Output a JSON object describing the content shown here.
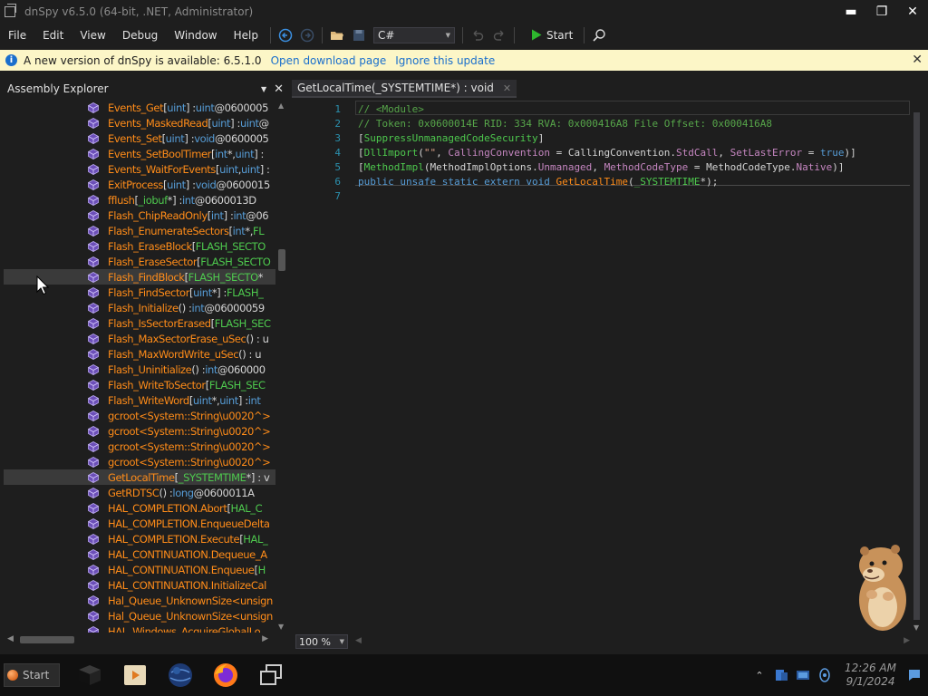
{
  "window": {
    "title": "dnSpy v6.5.0 (64-bit, .NET, Administrator)",
    "minimize": "▬",
    "maximize": "❐",
    "close": "✕"
  },
  "menu": {
    "items": [
      "File",
      "Edit",
      "View",
      "Debug",
      "Window",
      "Help"
    ]
  },
  "toolbar": {
    "language": "C#",
    "start_label": "Start"
  },
  "infobar": {
    "message": "A new version of dnSpy is available: 6.5.1.0",
    "open_download": "Open download page",
    "ignore_update": "Ignore this update",
    "close": "✕"
  },
  "assembly_explorer": {
    "title": "Assembly Explorer",
    "rows": [
      [
        [
          "n",
          "Events_Get"
        ],
        [
          "p",
          "["
        ],
        [
          "k",
          "uint"
        ],
        [
          "p",
          "] : "
        ],
        [
          "k",
          "uint"
        ],
        [
          "t",
          " @0600005"
        ]
      ],
      [
        [
          "n",
          "Events_MaskedRead"
        ],
        [
          "p",
          "["
        ],
        [
          "k",
          "uint"
        ],
        [
          "p",
          "] : "
        ],
        [
          "k",
          "uint"
        ],
        [
          "t",
          " @"
        ]
      ],
      [
        [
          "n",
          "Events_Set"
        ],
        [
          "p",
          "["
        ],
        [
          "k",
          "uint"
        ],
        [
          "p",
          "] : "
        ],
        [
          "k",
          "void"
        ],
        [
          "t",
          " @0600005"
        ]
      ],
      [
        [
          "n",
          "Events_SetBoolTimer"
        ],
        [
          "p",
          "["
        ],
        [
          "k",
          "int"
        ],
        [
          "p",
          "*, "
        ],
        [
          "k",
          "uint"
        ],
        [
          "p",
          "] :"
        ]
      ],
      [
        [
          "n",
          "Events_WaitForEvents"
        ],
        [
          "p",
          "["
        ],
        [
          "k",
          "uint"
        ],
        [
          "p",
          ", "
        ],
        [
          "k",
          "uint"
        ],
        [
          "p",
          "] :"
        ]
      ],
      [
        [
          "n",
          "ExitProcess"
        ],
        [
          "p",
          "["
        ],
        [
          "k",
          "uint"
        ],
        [
          "p",
          "] : "
        ],
        [
          "k",
          "void"
        ],
        [
          "t",
          " @0600015"
        ]
      ],
      [
        [
          "n",
          "fflush"
        ],
        [
          "p",
          "["
        ],
        [
          "y",
          "_iobuf"
        ],
        [
          "p",
          "*] : "
        ],
        [
          "k",
          "int"
        ],
        [
          "t",
          " @0600013D"
        ]
      ],
      [
        [
          "n",
          "Flash_ChipReadOnly"
        ],
        [
          "p",
          "["
        ],
        [
          "k",
          "int"
        ],
        [
          "p",
          "] : "
        ],
        [
          "k",
          "int"
        ],
        [
          "t",
          " @06"
        ]
      ],
      [
        [
          "n",
          "Flash_EnumerateSectors"
        ],
        [
          "p",
          "["
        ],
        [
          "k",
          "int"
        ],
        [
          "p",
          "*, "
        ],
        [
          "y",
          "FL"
        ]
      ],
      [
        [
          "n",
          "Flash_EraseBlock"
        ],
        [
          "p",
          "["
        ],
        [
          "y",
          "FLASH_SECTO"
        ]
      ],
      [
        [
          "n",
          "Flash_EraseSector"
        ],
        [
          "p",
          "["
        ],
        [
          "y",
          "FLASH_SECTO"
        ]
      ],
      [
        [
          "n",
          "Flash_FindBlock"
        ],
        [
          "p",
          "["
        ],
        [
          "y",
          "FLASH_SECTO"
        ],
        [
          "p",
          "*"
        ]
      ],
      [
        [
          "n",
          "Flash_FindSector"
        ],
        [
          "p",
          "["
        ],
        [
          "k",
          "uint"
        ],
        [
          "p",
          "*] : "
        ],
        [
          "y",
          "FLASH_"
        ]
      ],
      [
        [
          "n",
          "Flash_Initialize"
        ],
        [
          "p",
          "() : "
        ],
        [
          "k",
          "int"
        ],
        [
          "t",
          " @06000059"
        ]
      ],
      [
        [
          "n",
          "Flash_IsSectorErased"
        ],
        [
          "p",
          "["
        ],
        [
          "y",
          "FLASH_SEC"
        ]
      ],
      [
        [
          "n",
          "Flash_MaxSectorErase_uSec"
        ],
        [
          "p",
          "() : u"
        ]
      ],
      [
        [
          "n",
          "Flash_MaxWordWrite_uSec"
        ],
        [
          "p",
          "() : u"
        ]
      ],
      [
        [
          "n",
          "Flash_Uninitialize"
        ],
        [
          "p",
          "() : "
        ],
        [
          "k",
          "int"
        ],
        [
          "t",
          " @060000"
        ]
      ],
      [
        [
          "n",
          "Flash_WriteToSector"
        ],
        [
          "p",
          "["
        ],
        [
          "y",
          "FLASH_SEC"
        ]
      ],
      [
        [
          "n",
          "Flash_WriteWord"
        ],
        [
          "p",
          "["
        ],
        [
          "k",
          "uint"
        ],
        [
          "p",
          "*, "
        ],
        [
          "k",
          "uint"
        ],
        [
          "p",
          "] : "
        ],
        [
          "k",
          "int"
        ]
      ],
      [
        [
          "n",
          "gcroot<System::String\\u0020^>"
        ]
      ],
      [
        [
          "n",
          "gcroot<System::String\\u0020^>"
        ]
      ],
      [
        [
          "n",
          "gcroot<System::String\\u0020^>"
        ]
      ],
      [
        [
          "n",
          "gcroot<System::String\\u0020^>"
        ]
      ],
      [
        [
          "n",
          "GetLocalTime"
        ],
        [
          "p",
          "["
        ],
        [
          "y",
          "_SYSTEMTIME"
        ],
        [
          "p",
          "*] : v"
        ]
      ],
      [
        [
          "n",
          "GetRDTSC"
        ],
        [
          "p",
          "() : "
        ],
        [
          "k",
          "long"
        ],
        [
          "t",
          " @0600011A"
        ]
      ],
      [
        [
          "n",
          "HAL_COMPLETION.Abort"
        ],
        [
          "p",
          "["
        ],
        [
          "y",
          "HAL_C"
        ]
      ],
      [
        [
          "n",
          "HAL_COMPLETION.EnqueueDelta"
        ]
      ],
      [
        [
          "n",
          "HAL_COMPLETION.Execute"
        ],
        [
          "p",
          "["
        ],
        [
          "y",
          "HAL_"
        ]
      ],
      [
        [
          "n",
          "HAL_CONTINUATION.Dequeue_A"
        ]
      ],
      [
        [
          "n",
          "HAL_CONTINUATION.Enqueue"
        ],
        [
          "p",
          "["
        ],
        [
          "y",
          "H"
        ]
      ],
      [
        [
          "n",
          "HAL_CONTINUATION.InitializeCal"
        ]
      ],
      [
        [
          "n",
          "Hal_Queue_UnknownSize<unsign"
        ]
      ],
      [
        [
          "n",
          "Hal_Queue_UnknownSize<unsign"
        ]
      ],
      [
        [
          "n",
          "HAL_Windows_AcquireGlobalLo"
        ]
      ]
    ]
  },
  "editor": {
    "tab_title": "GetLocalTime(_SYSTEMTIME*) : void",
    "tab_close": "✕",
    "zoom": "100 %",
    "lines": [
      {
        "n": "1",
        "tokens": [
          [
            "cm",
            "// <Module>"
          ]
        ]
      },
      {
        "n": "2",
        "tokens": [
          [
            "cm",
            "// Token: 0x0600014E RID: 334 RVA: 0x000416A8 File Offset: 0x000416A8"
          ]
        ]
      },
      {
        "n": "3",
        "tokens": [
          [
            "tx",
            "["
          ],
          [
            "at",
            "SuppressUnmanagedCodeSecurity"
          ],
          [
            "tx",
            "]"
          ]
        ]
      },
      {
        "n": "4",
        "tokens": [
          [
            "tx",
            "["
          ],
          [
            "at",
            "DllImport"
          ],
          [
            "tx",
            "("
          ],
          [
            "st",
            "\"\""
          ],
          [
            "tx",
            ", "
          ],
          [
            "pr",
            "CallingConvention"
          ],
          [
            "tx",
            " = CallingConvention."
          ],
          [
            "pr",
            "StdCall"
          ],
          [
            "tx",
            ", "
          ],
          [
            "pr",
            "SetLastError"
          ],
          [
            "tx",
            " = "
          ],
          [
            "kw",
            "true"
          ],
          [
            "tx",
            ")]"
          ]
        ]
      },
      {
        "n": "5",
        "tokens": [
          [
            "tx",
            "["
          ],
          [
            "at",
            "MethodImpl"
          ],
          [
            "tx",
            "(MethodImplOptions."
          ],
          [
            "pr",
            "Unmanaged"
          ],
          [
            "tx",
            ", "
          ],
          [
            "pr",
            "MethodCodeType"
          ],
          [
            "tx",
            " = MethodCodeType."
          ],
          [
            "pr",
            "Native"
          ],
          [
            "tx",
            ")]"
          ]
        ]
      },
      {
        "n": "6",
        "tokens": [
          [
            "kw",
            "public unsafe static extern void "
          ],
          [
            "me",
            "GetLocalTime"
          ],
          [
            "tx",
            "("
          ],
          [
            "ty",
            "_SYSTEMTIME"
          ],
          [
            "tx",
            "*);"
          ]
        ]
      },
      {
        "n": "7",
        "tokens": []
      }
    ]
  },
  "taskbar": {
    "start_label": "Start",
    "time": "12:26 AM",
    "date": "9/1/2024"
  },
  "colors": {
    "accent": "#1a6fcc",
    "method": "#ff8c19",
    "keyword": "#569cd6",
    "type": "#4ec94e",
    "comment": "#57a64a",
    "infobar_bg": "#fcf6c7"
  }
}
